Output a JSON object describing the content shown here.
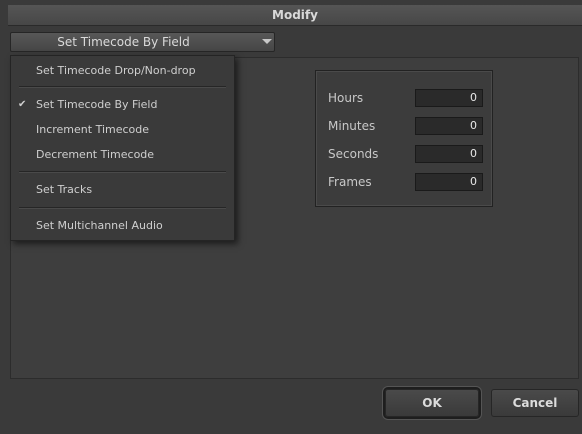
{
  "window": {
    "title": "Modify"
  },
  "dropdown": {
    "selected": "Set Timecode By Field"
  },
  "menu": {
    "items": [
      {
        "label": "Set Timecode Drop/Non-drop",
        "checked": false
      },
      {
        "label": "Set Timecode By Field",
        "checked": true
      },
      {
        "label": "Increment Timecode",
        "checked": false
      },
      {
        "label": "Decrement Timecode",
        "checked": false
      },
      {
        "label": "Set Tracks",
        "checked": false
      },
      {
        "label": "Set Multichannel Audio",
        "checked": false
      }
    ],
    "check_glyph": "✔"
  },
  "timecode": {
    "hours": {
      "label": "Hours",
      "value": "0"
    },
    "minutes": {
      "label": "Minutes",
      "value": "0"
    },
    "seconds": {
      "label": "Seconds",
      "value": "0"
    },
    "frames": {
      "label": "Frames",
      "value": "0"
    }
  },
  "buttons": {
    "ok": "OK",
    "cancel": "Cancel"
  },
  "colors": {
    "background": "#3a3a3a",
    "text": "#cfcfcf",
    "field_bg": "#2a2a2a"
  }
}
